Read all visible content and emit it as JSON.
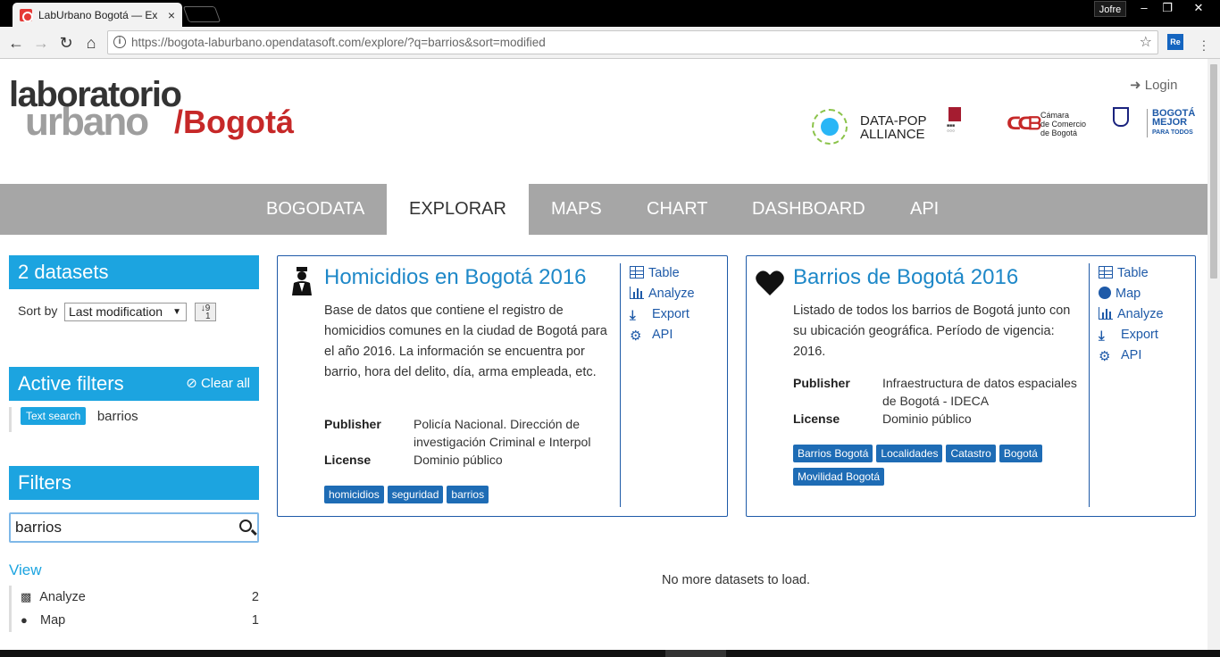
{
  "browser": {
    "tab_title": "LabUrbano Bogotá — Ex",
    "tab_close": "×",
    "profile": "Jofre",
    "url": "https://bogota-laburbano.opendatasoft.com/explore/?q=barrios&sort=modified",
    "extension_label": "Re",
    "win_min": "–",
    "win_restore": "❐",
    "win_close": "✕"
  },
  "header": {
    "logo_line1": "laboratorio",
    "logo_line2": "urbano",
    "logo_line3": "/Bogotá",
    "login": "Login",
    "partners": {
      "datapop_1": "DATA-POP",
      "datapop_2": "ALLIANCE",
      "ccb_1": "Cámara",
      "ccb_2": "de Comercio",
      "ccb_3": "de Bogotá",
      "bog_1": "BOGOTÁ",
      "bog_2": "MEJOR",
      "bog_3": "PARA TODOS"
    }
  },
  "nav": {
    "items": [
      {
        "label": "BOGODATA"
      },
      {
        "label": "EXPLORAR"
      },
      {
        "label": "MAPS"
      },
      {
        "label": "CHART"
      },
      {
        "label": "DASHBOARD"
      },
      {
        "label": "API"
      }
    ]
  },
  "sidebar": {
    "count_title": "2 datasets",
    "sort_label": "Sort by",
    "sort_value": "Last modification",
    "active_filters_title": "Active filters",
    "clear_all": "Clear all",
    "filter_tag": "Text search",
    "filter_value": "barrios",
    "filters_title": "Filters",
    "search_value": "barrios",
    "view_title": "View",
    "view_items": [
      {
        "label": "Analyze",
        "count": "2"
      },
      {
        "label": "Map",
        "count": "1"
      }
    ]
  },
  "datasets": [
    {
      "title": "Homicidios en Bogotá 2016",
      "description": "Base de datos que contiene el registro de homicidios comunes en la ciudad de Bogotá para el año 2016. La información se encuentra por barrio, hora del delito, día, arma empleada, etc.",
      "publisher_label": "Publisher",
      "publisher": "Policía Nacional. Dirección de investigación Criminal e Interpol",
      "license_label": "License",
      "license": "Dominio público",
      "tags": [
        "homicidios",
        "seguridad",
        "barrios"
      ],
      "actions": [
        "Table",
        "Analyze",
        "Export",
        "API"
      ]
    },
    {
      "title": "Barrios de Bogotá 2016",
      "description": "Listado de todos los barrios de Bogotá junto con su ubicación geográfica. Período de vigencia: 2016.",
      "publisher_label": "Publisher",
      "publisher": "Infraestructura de datos espaciales de Bogotá - IDECA",
      "license_label": "License",
      "license": "Dominio público",
      "tags": [
        "Barrios Bogotá",
        "Localidades",
        "Catastro",
        "Bogotá",
        "Movilidad Bogotá"
      ],
      "actions": [
        "Table",
        "Map",
        "Analyze",
        "Export",
        "API"
      ]
    }
  ],
  "no_more": "No more datasets to load.",
  "colors": {
    "accent": "#1ca4e0",
    "link": "#1e88c8",
    "card_border": "#1e5aa8",
    "tag": "#1e6cb5",
    "nav_bg": "#a6a6a6",
    "logo_red": "#c62828"
  }
}
